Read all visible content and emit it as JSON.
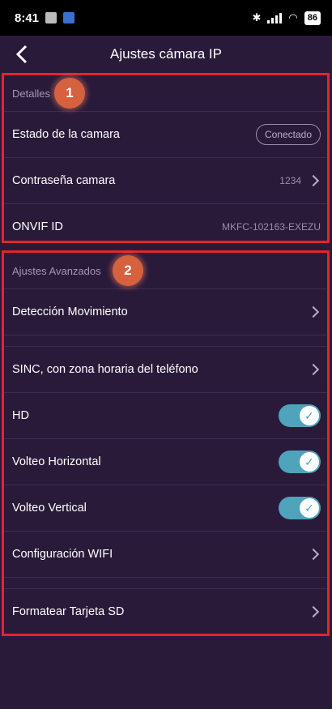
{
  "status_bar": {
    "time": "8:41",
    "battery": "86"
  },
  "header": {
    "back_icon": "chevron-left-icon",
    "title": "Ajustes cámara IP"
  },
  "colors": {
    "background": "#2a1a3a",
    "highlight_border": "#e0262e",
    "badge": "#d6613f",
    "toggle_on": "#4fa3bb"
  },
  "section_details": {
    "badge": "1",
    "title": "Detalles",
    "camera_state_label": "Estado de la camara",
    "camera_state_value": "Conectado",
    "password_label": "Contraseña camara",
    "password_value": "1234",
    "onvif_label": "ONVIF ID",
    "onvif_value": "MKFC-102163-EXEZU"
  },
  "section_advanced": {
    "badge": "2",
    "title": "Ajustes Avanzados",
    "motion_label": "Detección Movimiento",
    "sync_label": "SINC, con zona horaria del teléfono",
    "hd_label": "HD",
    "hd_on": true,
    "flip_h_label": "Volteo Horizontal",
    "flip_h_on": true,
    "flip_v_label": "Volteo Vertical",
    "flip_v_on": true,
    "wifi_label": "Configuración WIFI",
    "sd_label": "Formatear Tarjeta SD"
  }
}
